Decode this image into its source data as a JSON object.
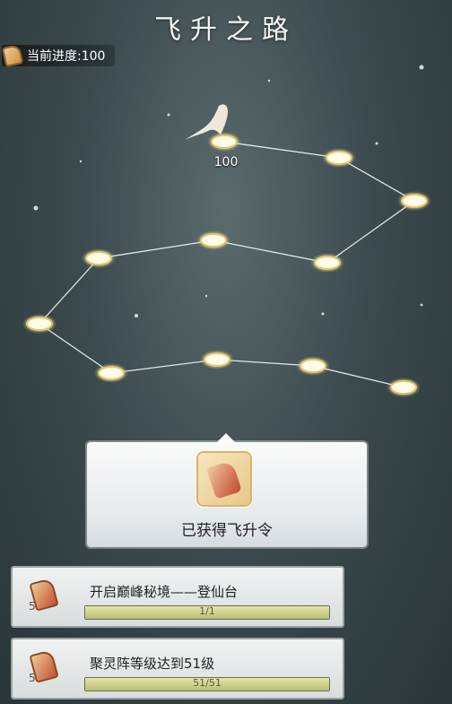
{
  "header": {
    "title": "飞升之路"
  },
  "progress": {
    "label": "当前进度:100"
  },
  "map": {
    "node_value": "100"
  },
  "popup": {
    "label": "已获得飞升令"
  },
  "tasks": [
    {
      "name": "开启巅峰秘境——登仙台",
      "reward_count": "5",
      "progress_text": "1/1",
      "progress_fraction": 1.0
    },
    {
      "name": "聚灵阵等级达到51级",
      "reward_count": "5",
      "progress_text": "51/51",
      "progress_fraction": 1.0
    }
  ],
  "colors": {
    "node_glow": "#f3e3a0",
    "path_line": "#ffffff"
  }
}
